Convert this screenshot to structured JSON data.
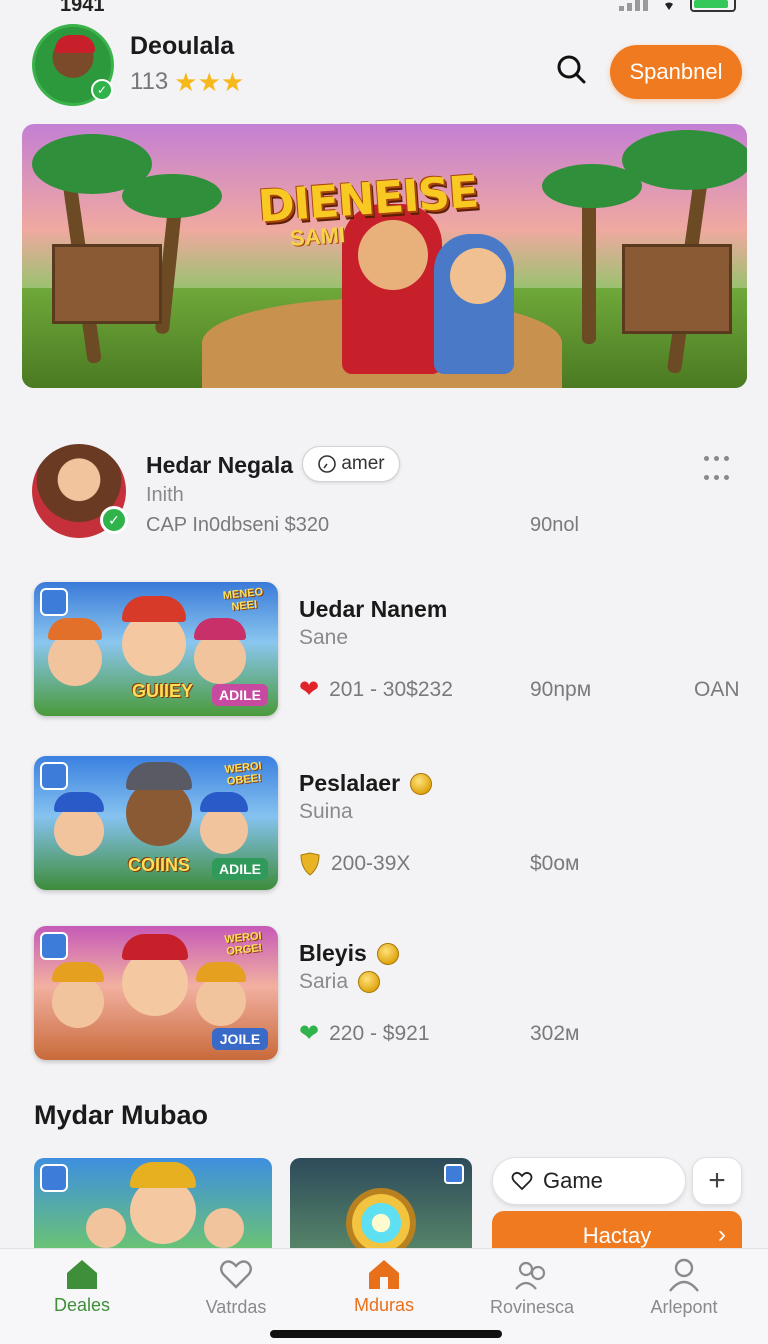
{
  "status": {
    "time": "1941"
  },
  "profile": {
    "name": "Deoulala",
    "level": "113",
    "stars": "★★★"
  },
  "header": {
    "primary_button": "Spanbnel"
  },
  "banner": {
    "title": "DIENEISE",
    "subtitle": "SAMI"
  },
  "featured": {
    "name": "Hedar Negala",
    "tag": "amer",
    "subtitle": "Inith",
    "meta": "CAP In0dbseni  $320",
    "time": "90nol"
  },
  "games": [
    {
      "title": "Uedar Nanem",
      "subtitle": "Sane",
      "price": "201 - 30$232",
      "time": "90npм",
      "extra": "OAN",
      "price_icon": "heart-red",
      "thumb_label": "GUIIEY",
      "thumb_badge": "ADILE",
      "thumb_logo": "MENEO NEEI"
    },
    {
      "title": "Peslalaer",
      "subtitle": "Suina",
      "price": "200-39X",
      "time": "$0ом",
      "extra": "",
      "price_icon": "shield-gold",
      "thumb_label": "COIINS",
      "thumb_badge": "ADILE",
      "thumb_logo": "WEROI OBEE!"
    },
    {
      "title": "Bleyis",
      "subtitle": "Saria",
      "price": "220 - $921",
      "time": "302м",
      "extra": "",
      "price_icon": "heart-green",
      "thumb_label": "",
      "thumb_badge": "JOILE",
      "thumb_logo": "WEROI ORGE!"
    }
  ],
  "section": {
    "title": "Mydar Mubao"
  },
  "actions": {
    "game_pill": "Game",
    "cta": "Hactay",
    "plus": "+"
  },
  "tabs": [
    {
      "label": "Deales",
      "icon": "home-icon",
      "state": "active-green"
    },
    {
      "label": "Vatrdas",
      "icon": "heart-outline-icon",
      "state": ""
    },
    {
      "label": "Mduras",
      "icon": "house-orange-icon",
      "state": "active-orange"
    },
    {
      "label": "Rovinesca",
      "icon": "people-icon",
      "state": ""
    },
    {
      "label": "Arlepont",
      "icon": "person-icon",
      "state": ""
    }
  ],
  "colors": {
    "accent": "#f07a1f",
    "green": "#3f8e3a",
    "background": "#f3f3f5"
  }
}
